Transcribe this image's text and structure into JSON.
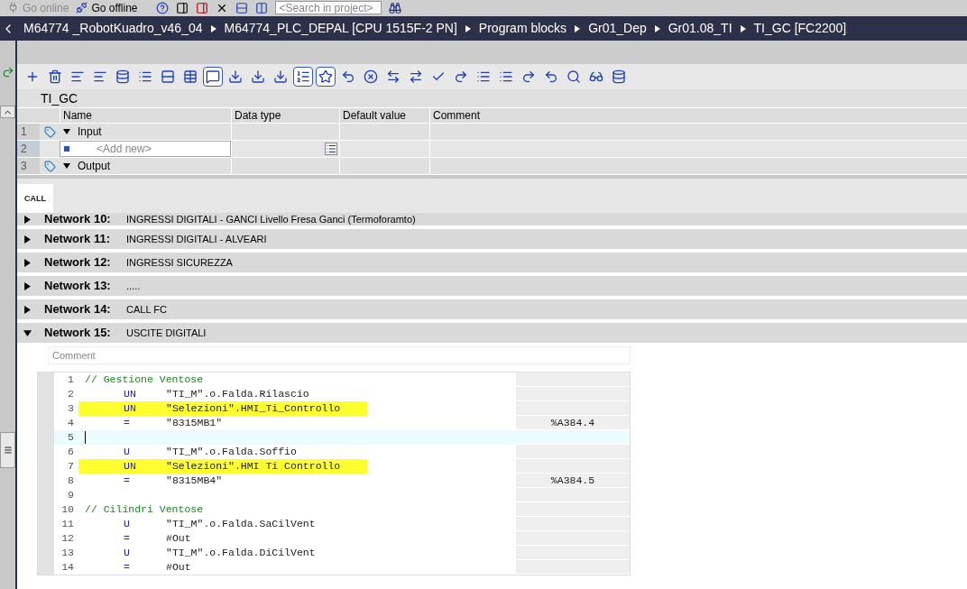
{
  "top_toolbar": {
    "buttons": [
      {
        "label": "Go online",
        "disabled": true
      },
      {
        "label": "Go offline",
        "disabled": false
      }
    ],
    "search": {
      "placeholder": "<Search in project>"
    }
  },
  "breadcrumb": [
    "M64774 _RobotKuadro_v46_04",
    "M64774_PLC_DEPAL [CPU 1515F-2 PN]",
    "Program blocks",
    "Gr01_Dep",
    "Gr01.08_TI",
    "TI_GC [FC2200]"
  ],
  "block_title": "TI_GC",
  "interface": {
    "columns": [
      "Name",
      "Data type",
      "Default value",
      "Comment"
    ],
    "rows": [
      {
        "num": "1",
        "kind": "section",
        "name": "Input",
        "expanded": true,
        "selected": false
      },
      {
        "num": "2",
        "kind": "add",
        "placeholder": "<Add new>",
        "selected": true
      },
      {
        "num": "3",
        "kind": "section",
        "name": "Output",
        "expanded": true,
        "selected": false
      }
    ]
  },
  "tab": "CALL",
  "networks": [
    {
      "label": "Network 10:",
      "title": "INGRESSI DIGITALI - GANCI  Livello Fresa Ganci  (Termoforamto)",
      "expanded": false
    },
    {
      "label": "Network 11:",
      "title": "INGRESSI DIGITALI - ALVEARI",
      "expanded": false
    },
    {
      "label": "Network 12:",
      "title": "INGRESSI SICUREZZA",
      "expanded": false
    },
    {
      "label": "Network 13:",
      "title": ".....",
      "expanded": false
    },
    {
      "label": "Network 14:",
      "title": "CALL FC",
      "expanded": false
    },
    {
      "label": "Network 15:",
      "title": "USCITE DIGITALI",
      "expanded": true
    }
  ],
  "comment_placeholder": "Comment",
  "code_lines": [
    {
      "num": "1",
      "kind": "comment",
      "text": "// Gestione Ventose",
      "highlighted": false,
      "current": false
    },
    {
      "num": "2",
      "kind": "instruction",
      "op": "UN",
      "operand": "\"TI_M\".o.Falda.Rilascio",
      "highlighted": false,
      "current": false
    },
    {
      "num": "3",
      "kind": "instruction",
      "op": "UN",
      "operand": "\"Selezioni\".HMI_Ti_Controllo",
      "highlighted": true,
      "current": false
    },
    {
      "num": "4",
      "kind": "instruction",
      "op": "=",
      "operand": "\"8315MB1\"",
      "address": "%A384.4",
      "highlighted": false,
      "current": false
    },
    {
      "num": "5",
      "kind": "blank",
      "highlighted": false,
      "current": true
    },
    {
      "num": "6",
      "kind": "instruction",
      "op": "U",
      "operand": "\"TI_M\".o.Falda.Soffio",
      "highlighted": false,
      "current": false
    },
    {
      "num": "7",
      "kind": "instruction",
      "op": "UN",
      "operand": "\"Selezioni\".HMI Ti Controllo",
      "highlighted": true,
      "current": false
    },
    {
      "num": "8",
      "kind": "instruction",
      "op": "=",
      "operand": "\"8315MB4\"",
      "address": "%A384.5",
      "highlighted": false,
      "current": false
    },
    {
      "num": "9",
      "kind": "blank",
      "highlighted": false,
      "current": false
    },
    {
      "num": "10",
      "kind": "comment",
      "text": "// Cilindri Ventose",
      "highlighted": false,
      "current": false
    },
    {
      "num": "11",
      "kind": "instruction",
      "op": "U",
      "operand": "\"TI_M\".o.Falda.SaCilVent",
      "highlighted": false,
      "current": false
    },
    {
      "num": "12",
      "kind": "instruction",
      "op": "=",
      "operand": "#Out",
      "highlighted": false,
      "current": false
    },
    {
      "num": "13",
      "kind": "instruction",
      "op": "U",
      "operand": "\"TI_M\".o.Falda.DiCilVent",
      "highlighted": false,
      "current": false
    },
    {
      "num": "14",
      "kind": "instruction",
      "op": "=",
      "operand": "#Out",
      "highlighted": false,
      "current": false
    }
  ]
}
